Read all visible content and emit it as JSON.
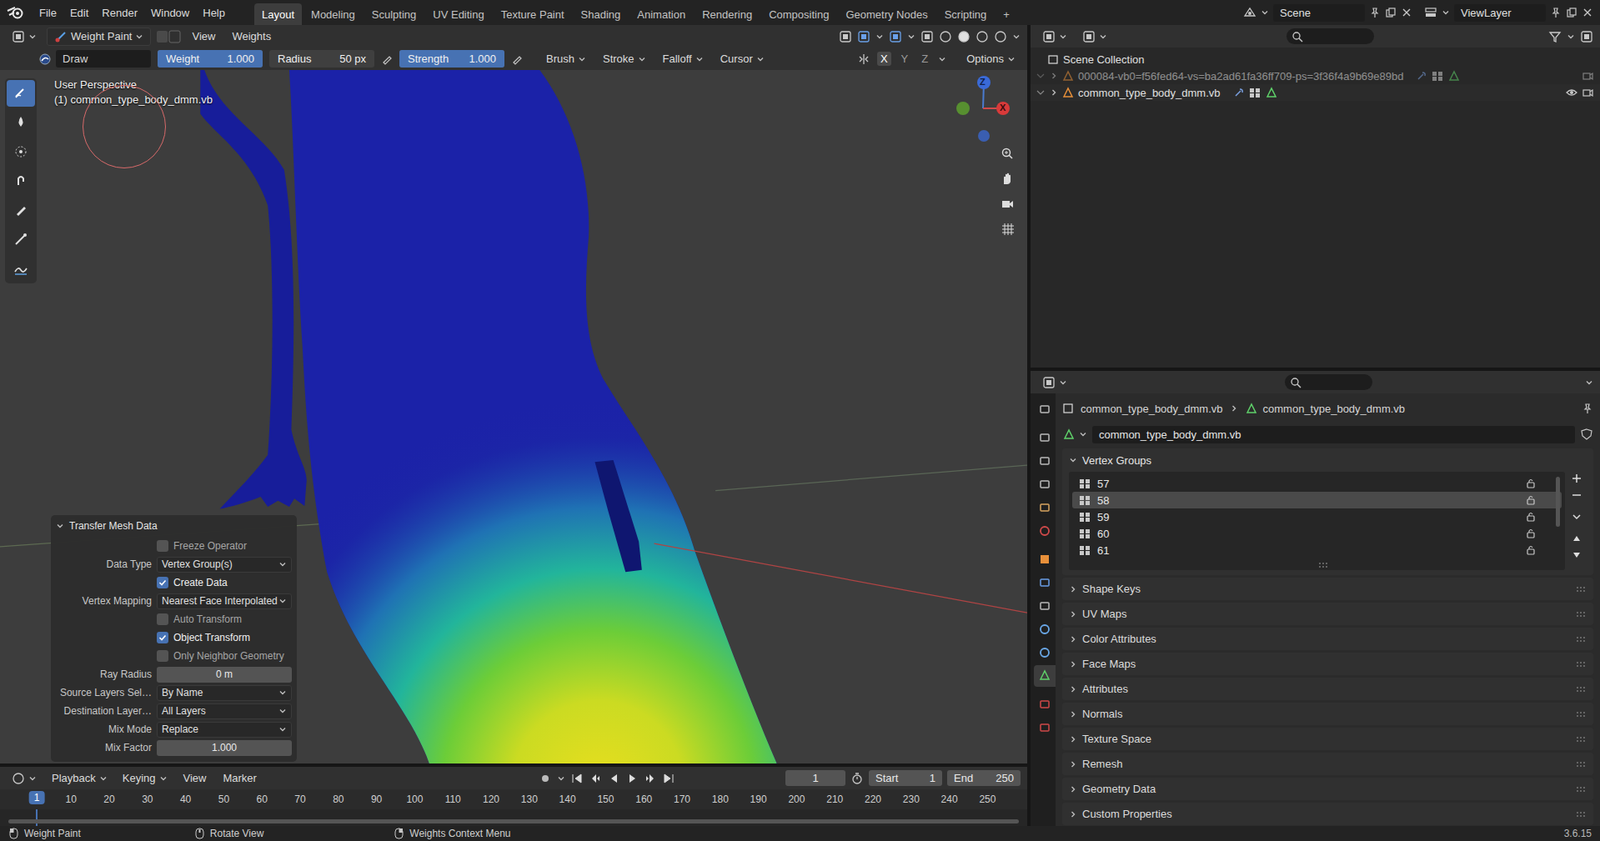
{
  "top_bar": {
    "menus": [
      "File",
      "Edit",
      "Render",
      "Window",
      "Help"
    ],
    "workspaces": [
      {
        "label": "Layout",
        "selected": true
      },
      {
        "label": "Modeling",
        "selected": false
      },
      {
        "label": "Sculpting",
        "selected": false
      },
      {
        "label": "UV Editing",
        "selected": false
      },
      {
        "label": "Texture Paint",
        "selected": false
      },
      {
        "label": "Shading",
        "selected": false
      },
      {
        "label": "Animation",
        "selected": false
      },
      {
        "label": "Rendering",
        "selected": false
      },
      {
        "label": "Compositing",
        "selected": false
      },
      {
        "label": "Geometry Nodes",
        "selected": false
      },
      {
        "label": "Scripting",
        "selected": false
      }
    ],
    "add": "+",
    "scene": "Scene",
    "view_layer": "ViewLayer"
  },
  "viewport": {
    "mode": "Weight Paint",
    "menus": [
      "View",
      "Weights"
    ],
    "overlay_view": "User Perspective",
    "overlay_object": "(1) common_type_body_dmm.vb",
    "tools": [
      {
        "selected": true
      },
      {
        "selected": false
      },
      {
        "selected": false
      },
      {
        "selected": false
      },
      {
        "selected": false
      },
      {
        "selected": false
      },
      {
        "selected": false
      }
    ],
    "gizmo": {
      "z": "Z",
      "x": "X"
    }
  },
  "tool_settings": {
    "brush": "Draw",
    "fields": [
      {
        "label": "Weight",
        "value": "1.000",
        "level": 1.0
      },
      {
        "label": "Radius",
        "value": "50 px"
      },
      {
        "label": "Strength",
        "value": "1.000",
        "level": 1.0
      }
    ],
    "menus": [
      "Brush",
      "Stroke",
      "Falloff",
      "Cursor"
    ],
    "axes": [
      {
        "label": "X",
        "selected": true
      },
      {
        "label": "Y",
        "selected": false
      },
      {
        "label": "Z",
        "selected": false
      }
    ],
    "options": "Options"
  },
  "operator_panel": {
    "title": "Transfer Mesh Data",
    "expanded": true,
    "rows": [
      {
        "kind": "checkbox",
        "label": "",
        "text": "Freeze Operator",
        "checked": false
      },
      {
        "kind": "dropdown",
        "label": "Data Type",
        "value": "Vertex Group(s)"
      },
      {
        "kind": "checkbox",
        "label": "",
        "text": "Create Data",
        "checked": true
      },
      {
        "kind": "dropdown",
        "label": "Vertex Mapping",
        "value": "Nearest Face Interpolated"
      },
      {
        "kind": "checkbox",
        "label": "",
        "text": "Auto Transform",
        "checked": false
      },
      {
        "kind": "checkbox",
        "label": "",
        "text": "Object Transform",
        "checked": true
      },
      {
        "kind": "checkbox",
        "label": "",
        "text": "Only Neighbor Geometry",
        "checked": false
      },
      {
        "kind": "field",
        "label": "Ray Radius",
        "value": "0 m"
      },
      {
        "kind": "dropdown",
        "label": "Source Layers Sel…",
        "value": "By Name"
      },
      {
        "kind": "dropdown",
        "label": "Destination Layer…",
        "value": "All Layers"
      },
      {
        "kind": "dropdown",
        "label": "Mix Mode",
        "value": "Replace"
      },
      {
        "kind": "field",
        "label": "Mix Factor",
        "value": "1.000"
      }
    ]
  },
  "timeline": {
    "menus": [
      "Playback",
      "Keying",
      "View",
      "Marker"
    ],
    "current_frame": "1",
    "start_label": "Start",
    "start": "1",
    "end_label": "End",
    "end": "250",
    "ticks": [
      "10",
      "20",
      "30",
      "40",
      "50",
      "60",
      "70",
      "80",
      "90",
      "100",
      "110",
      "120",
      "130",
      "140",
      "150",
      "160",
      "170",
      "180",
      "190",
      "200",
      "210",
      "220",
      "230",
      "240",
      "250"
    ],
    "playhead": "1"
  },
  "outliner": {
    "root": "Scene Collection",
    "items": [
      {
        "label": "000084-vb0=f56fed64-vs=ba2ad61fa36ff709-ps=3f36f4a9b69e89bd",
        "dimmed": true,
        "expanded": false
      },
      {
        "label": "common_type_body_dmm.vb",
        "dimmed": false,
        "expanded": false
      }
    ]
  },
  "properties": {
    "tabs": [
      {
        "selected": false
      },
      {
        "selected": false
      },
      {
        "selected": false
      },
      {
        "selected": false
      },
      {
        "selected": false
      },
      {
        "selected": false
      },
      {
        "selected": false
      },
      {
        "selected": false
      },
      {
        "selected": false
      },
      {
        "selected": false
      },
      {
        "selected": false
      },
      {
        "selected": true
      },
      {
        "selected": false
      },
      {
        "selected": false
      }
    ],
    "breadcrumb": [
      "common_type_body_dmm.vb",
      "common_type_body_dmm.vb"
    ],
    "mesh_name": "common_type_body_dmm.vb",
    "vertex_groups": {
      "title": "Vertex Groups",
      "expanded": true,
      "items": [
        {
          "name": "57",
          "selected": false
        },
        {
          "name": "58",
          "selected": true
        },
        {
          "name": "59",
          "selected": false
        },
        {
          "name": "60",
          "selected": false
        },
        {
          "name": "61",
          "selected": false
        }
      ]
    },
    "panels": [
      {
        "label": "Shape Keys",
        "expanded": false
      },
      {
        "label": "UV Maps",
        "expanded": false
      },
      {
        "label": "Color Attributes",
        "expanded": false
      },
      {
        "label": "Face Maps",
        "expanded": false
      },
      {
        "label": "Attributes",
        "expanded": false
      },
      {
        "label": "Normals",
        "expanded": false
      },
      {
        "label": "Texture Space",
        "expanded": false
      },
      {
        "label": "Remesh",
        "expanded": false
      },
      {
        "label": "Geometry Data",
        "expanded": false
      },
      {
        "label": "Custom Properties",
        "expanded": false
      }
    ]
  },
  "status_bar": {
    "items": [
      "Weight Paint",
      "Rotate View",
      "Weights Context Menu"
    ],
    "version": "3.6.15"
  }
}
